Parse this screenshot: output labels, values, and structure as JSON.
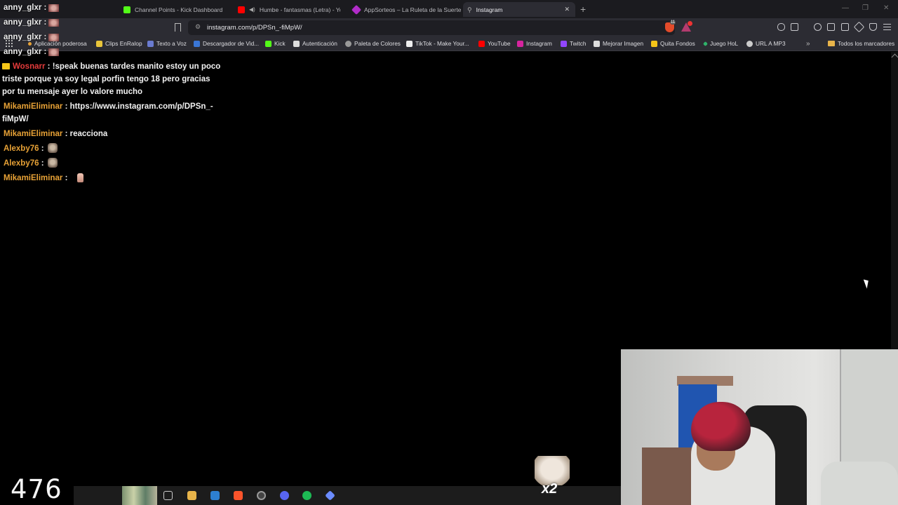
{
  "tabs": [
    {
      "label": "Channel Points - Kick Dashboard",
      "favicon_color": "#53fc18"
    },
    {
      "label": "Humbe - fantasmas (Letra) - You",
      "favicon_color": "#ff0000"
    },
    {
      "label": "AppSorteos – La Ruleta de la Suerte",
      "favicon_color": "#b12cc9"
    },
    {
      "label": "Instagram",
      "favicon_color": "#bbbbbb",
      "active": true
    }
  ],
  "address_bar": {
    "url": "instagram.com/p/DPSn_-fiMpW/"
  },
  "shields_badge": "11",
  "bookmarks": [
    {
      "label": "Aplicación poderosa",
      "icon": "dot-icon",
      "color": "#e8a236"
    },
    {
      "label": "Clips EnRalop",
      "icon": "clips-icon",
      "color": "#e8c43a"
    },
    {
      "label": "Texto a Voz",
      "icon": "tts-icon",
      "color": "#6a7bd0"
    },
    {
      "label": "Descargador de Vid...",
      "icon": "download-icon",
      "color": "#3a76d6"
    },
    {
      "label": "Kick",
      "icon": "kick-icon",
      "color": "#53fc18"
    },
    {
      "label": "Autenticación",
      "icon": "r-icon",
      "color": "#dddddd"
    },
    {
      "label": "Paleta de Colores",
      "icon": "palette-icon",
      "color": "#cccccc"
    },
    {
      "label": "TikTok - Make Your...",
      "icon": "tiktok-icon",
      "color": "#eeeeee"
    },
    {
      "label": "YouTube",
      "icon": "youtube-icon",
      "color": "#ff0000"
    },
    {
      "label": "Instagram",
      "icon": "instagram-icon",
      "color": "#d6249f"
    },
    {
      "label": "Twitch",
      "icon": "twitch-icon",
      "color": "#9146ff"
    },
    {
      "label": "Mejorar Imagen",
      "icon": "p-icon",
      "color": "#dddddd"
    },
    {
      "label": "Quita Fondos",
      "icon": "bg-remove-icon",
      "color": "#f5c518"
    },
    {
      "label": "Juego HoL",
      "icon": "game-icon",
      "color": "#2fb36a"
    },
    {
      "label": "URL A MP3",
      "icon": "mp3-icon",
      "color": "#cccccc"
    }
  ],
  "all_bookmarks_label": "Todos los marcadores",
  "overlay_users": [
    "anny_glxr :",
    "anny_glxr :",
    "anny_glxr :",
    "anny_glxr :"
  ],
  "chat": [
    {
      "user": "Wosnarr",
      "sep": " : ",
      "text": "!speak buenas tardes manito estoy un poco triste porque ya soy legal porfin tengo 18 pero gracias por tu mensaje ayer lo valore mucho"
    },
    {
      "user": "MikamiEliminar",
      "sep": " : ",
      "text": "https://www.instagram.com/p/DPSn_-fiMpW/"
    },
    {
      "user": "MikamiEliminar",
      "sep": " : ",
      "text": "reacciona"
    },
    {
      "user": "Alexby76",
      "sep": " : ",
      "text": ""
    },
    {
      "user": "Alexby76",
      "sep": " : ",
      "text": ""
    },
    {
      "user": "MikamiEliminar",
      "sep": " : ",
      "text": ""
    }
  ],
  "counter": "476",
  "sticker_multiplier": "x2"
}
